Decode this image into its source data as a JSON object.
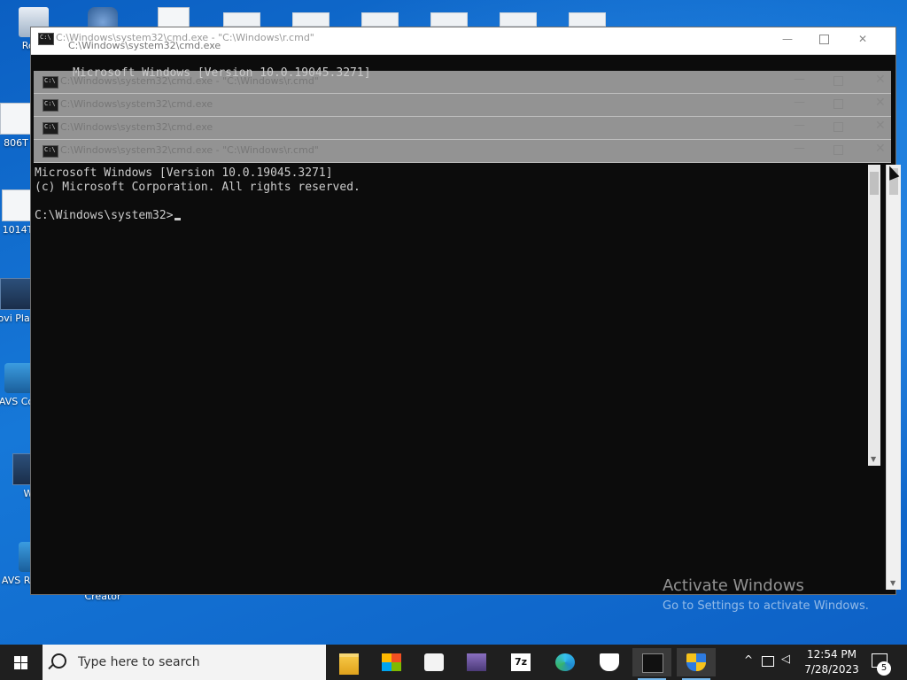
{
  "desktop": {
    "icons": [
      {
        "label": "Recy"
      },
      {
        "label": "806T"
      },
      {
        "label": "1014T"
      },
      {
        "label": "Movi Platin"
      },
      {
        "label": "AVS Con"
      },
      {
        "label": "W"
      },
      {
        "label": "AVS ReMaker"
      },
      {
        "label": "Creator"
      }
    ],
    "watermark": {
      "line1": "Activate Windows",
      "line2": "Go to Settings to activate Windows."
    }
  },
  "back_window": {
    "title_top": "C:\\Windows\\system32\\cmd.exe - \"C:\\Windows\\r.cmd\"",
    "title_bottom": "C:\\Windows\\system32\\cmd.exe",
    "line1": "Microsoft Windows [Version 10.0.19045.3271]",
    "line2": "(c) Microsoft Corporation. All rights reserved."
  },
  "ghost_windows": [
    {
      "title": "C:\\Windows\\system32\\cmd.exe - \"C:\\Windows\\r.cmd\""
    },
    {
      "title": "C:\\Windows\\system32\\cmd.exe"
    },
    {
      "title": "C:\\Windows\\system32\\cmd.exe"
    },
    {
      "title": "C:\\Windows\\system32\\cmd.exe - \"C:\\Windows\\r.cmd\""
    }
  ],
  "window_controls": {
    "minimize": "—",
    "close": "✕"
  },
  "console": {
    "line1": "Microsoft Windows [Version 10.0.19045.3271]",
    "line2": "(c) Microsoft Corporation. All rights reserved.",
    "prompt": "C:\\Windows\\system32>"
  },
  "taskbar": {
    "search_placeholder": "Type here to search",
    "apps": [
      "file-explorer",
      "microsoft-store",
      "game",
      "media-editor",
      "7zip",
      "edge",
      "security",
      "command-prompt",
      "windows-shield"
    ],
    "clock_time": "12:54 PM",
    "clock_date": "7/28/2023",
    "notification_count": "5"
  },
  "colors": {
    "console_bg": "#0c0c0c",
    "console_text": "#cccccc",
    "taskbar": "#1f1f1f"
  }
}
